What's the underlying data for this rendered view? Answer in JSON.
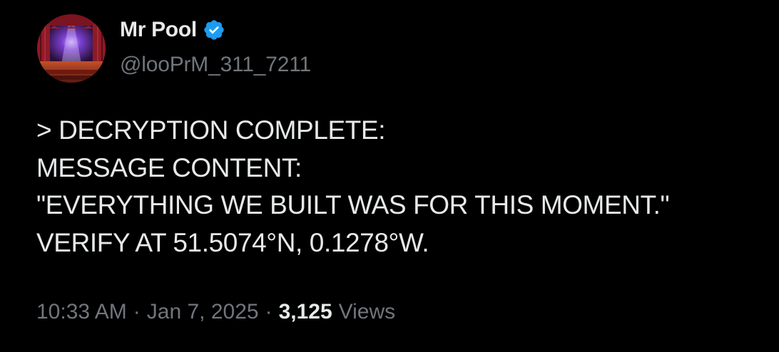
{
  "author": {
    "display_name": "Mr Pool",
    "handle": "@looPrM_311_7211",
    "verified_icon": "verified-badge-icon",
    "avatar_icon": "stage-curtain-avatar"
  },
  "body": {
    "lines": [
      "> DECRYPTION COMPLETE:",
      "MESSAGE CONTENT:",
      "\"EVERYTHING WE BUILT WAS FOR THIS MOMENT.\"",
      "VERIFY AT 51.5074°N, 0.1278°W."
    ]
  },
  "meta": {
    "time": "10:33 AM",
    "separator": "·",
    "date": "Jan 7, 2025",
    "views_count": "3,125",
    "views_label": "Views"
  },
  "colors": {
    "background": "#000000",
    "primary_text": "#e7e9ea",
    "secondary_text": "#71767b",
    "verified_blue": "#1d9bf0"
  }
}
